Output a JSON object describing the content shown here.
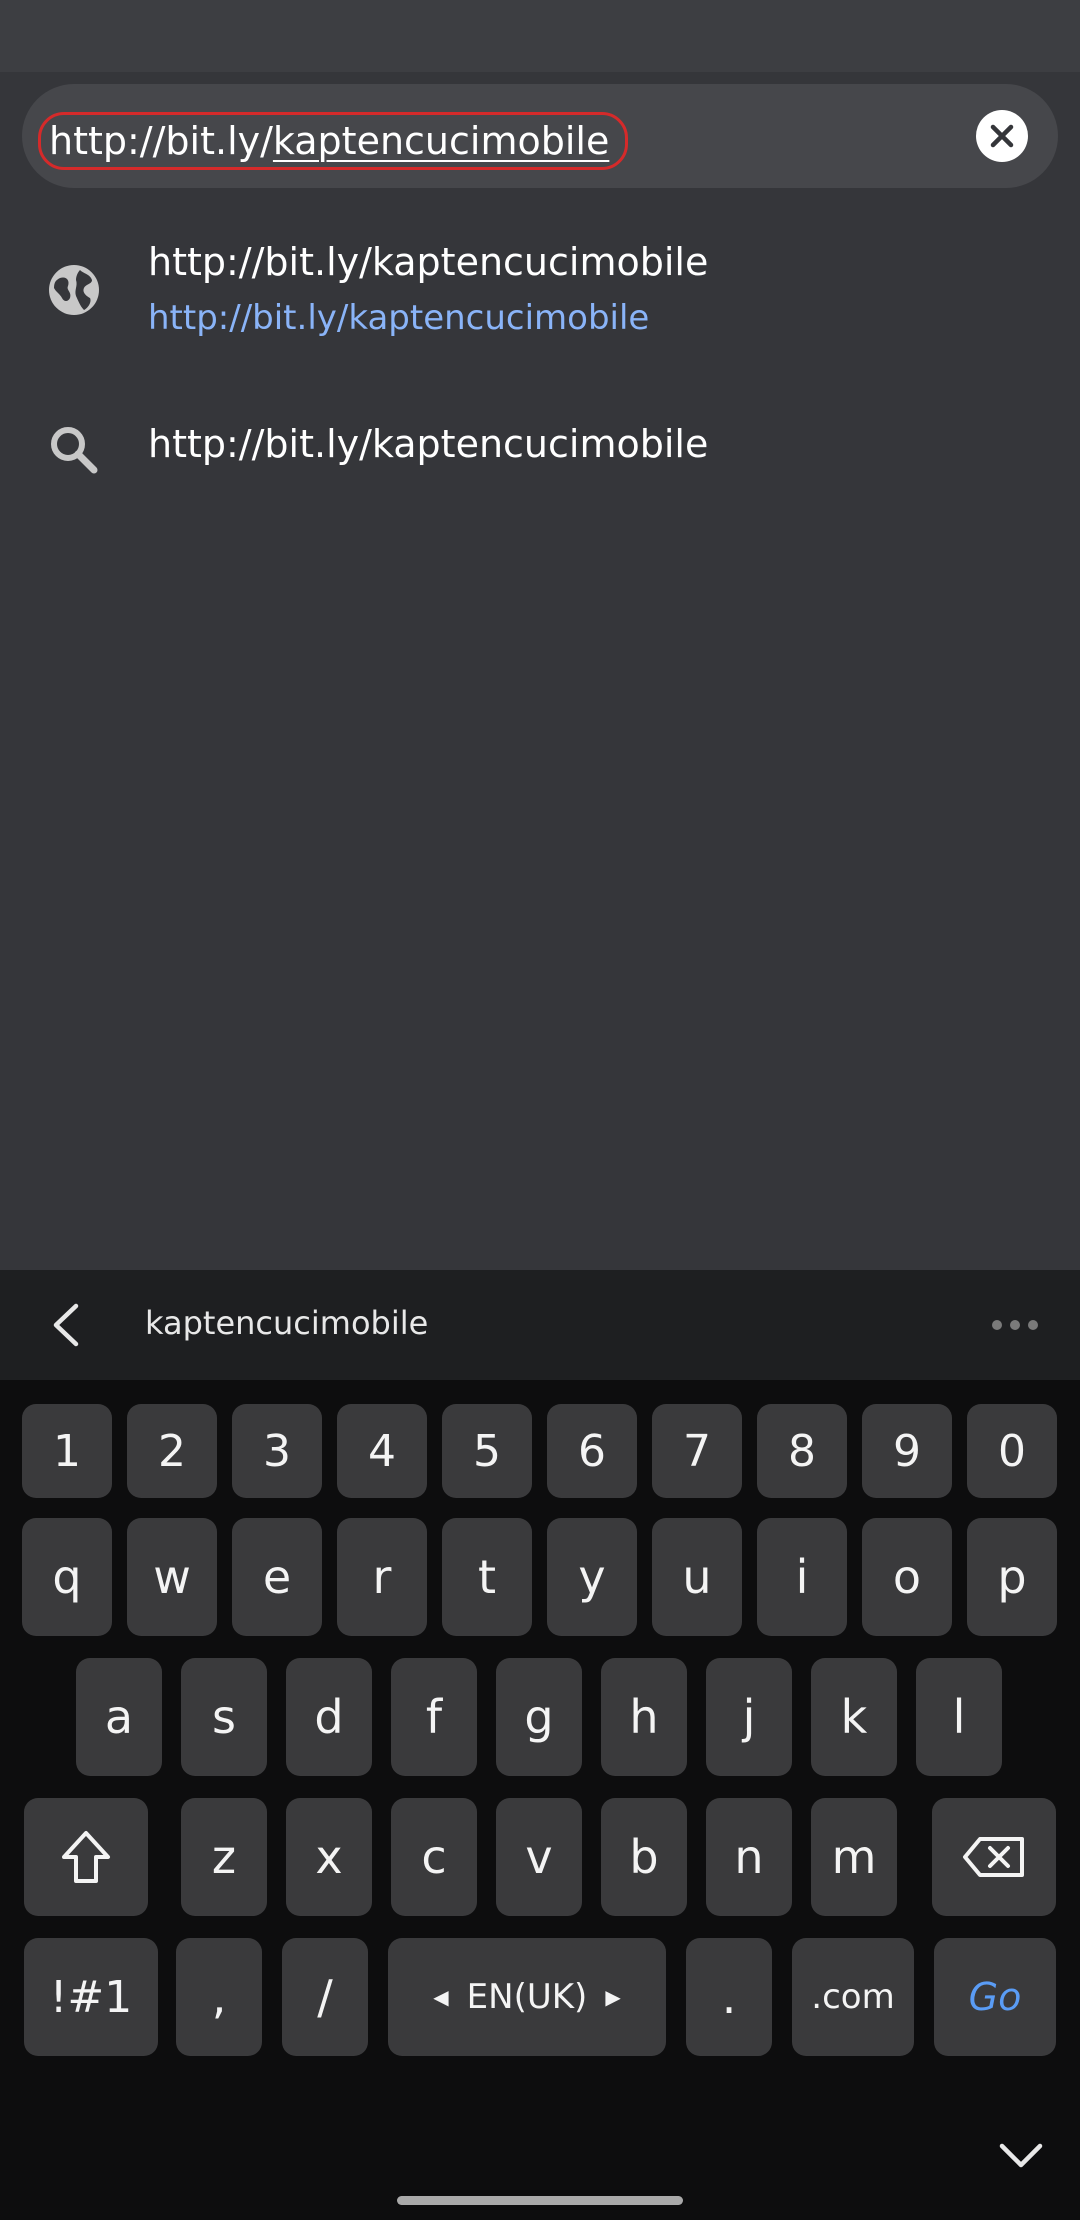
{
  "url_bar": {
    "prefix": "http://bit.ly/",
    "typed": "kaptencucimobile",
    "clear_icon": "close-icon"
  },
  "suggestions": [
    {
      "icon": "globe-icon",
      "title": "http://bit.ly/kaptencucimobile",
      "url": "http://bit.ly/kaptencucimobile"
    },
    {
      "icon": "search-icon",
      "title": "http://bit.ly/kaptencucimobile"
    }
  ],
  "keyboard": {
    "prediction": "kaptencucimobile",
    "number_row": [
      "1",
      "2",
      "3",
      "4",
      "5",
      "6",
      "7",
      "8",
      "9",
      "0"
    ],
    "row1": [
      "q",
      "w",
      "e",
      "r",
      "t",
      "y",
      "u",
      "i",
      "o",
      "p"
    ],
    "row2": [
      "a",
      "s",
      "d",
      "f",
      "g",
      "h",
      "j",
      "k",
      "l"
    ],
    "row3": [
      "z",
      "x",
      "c",
      "v",
      "b",
      "n",
      "m"
    ],
    "symbols_label": "!#1",
    "comma": ",",
    "slash": "/",
    "language": "EN(UK)",
    "period": ".",
    "dotcom": ".com",
    "go_label": "Go"
  }
}
